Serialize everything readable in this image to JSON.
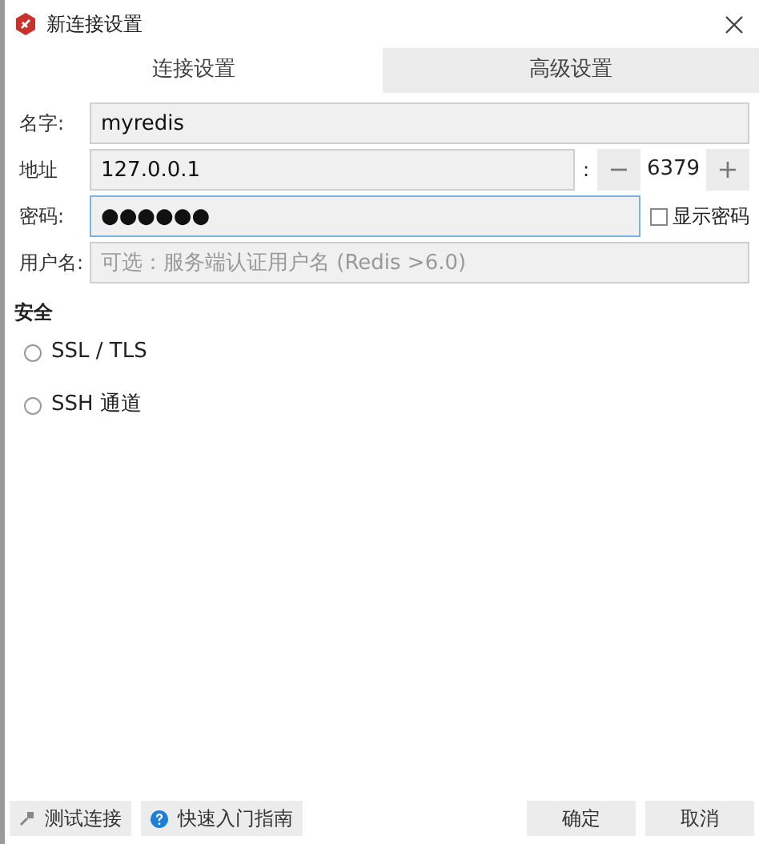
{
  "window": {
    "title": "新连接设置"
  },
  "tabs": [
    {
      "label": "连接设置",
      "selected": true
    },
    {
      "label": "高级设置",
      "selected": false
    }
  ],
  "fields": [
    {
      "kind": "text",
      "label": "名字:",
      "value": "myredis",
      "focused": false
    },
    {
      "kind": "address",
      "label": "地址",
      "value": "127.0.0.1",
      "focused": false,
      "separator": ":",
      "port": {
        "minus": "−",
        "value": "6379",
        "plus": "+"
      }
    },
    {
      "kind": "password",
      "label": "密码:",
      "value": "●●●●●●",
      "focused": true,
      "show_password": {
        "label": "显示密码",
        "checked": false
      }
    },
    {
      "kind": "text",
      "label": "用户名:",
      "placeholder": "可选：服务端认证用户名 (Redis >6.0)",
      "focused": false
    }
  ],
  "security": {
    "title": "安全",
    "options": [
      {
        "label": "SSL / TLS",
        "selected": false
      },
      {
        "label": "SSH 通道",
        "selected": false
      }
    ]
  },
  "footer": {
    "left": [
      {
        "kind": "test",
        "label": "测试连接"
      },
      {
        "kind": "help",
        "label": "快速入门指南"
      }
    ],
    "right": [
      {
        "label": "确定"
      },
      {
        "label": "取消"
      }
    ]
  }
}
